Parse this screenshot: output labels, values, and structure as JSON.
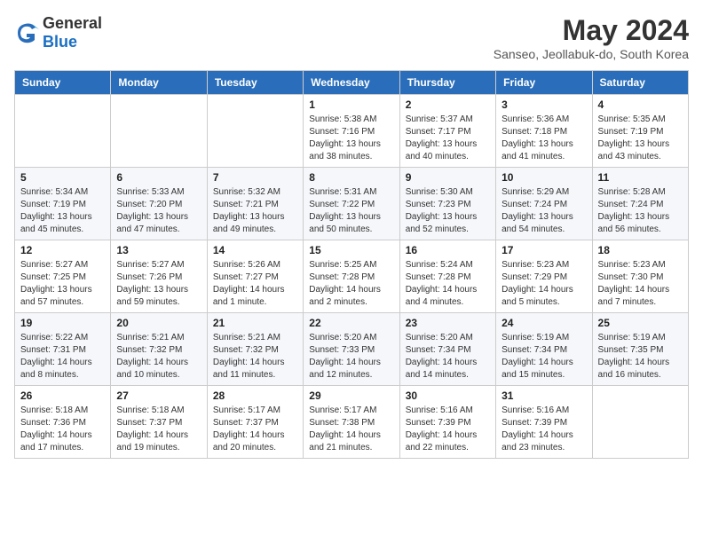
{
  "header": {
    "logo_general": "General",
    "logo_blue": "Blue",
    "month_title": "May 2024",
    "subtitle": "Sanseo, Jeollabuk-do, South Korea"
  },
  "weekdays": [
    "Sunday",
    "Monday",
    "Tuesday",
    "Wednesday",
    "Thursday",
    "Friday",
    "Saturday"
  ],
  "weeks": [
    [
      {
        "day": "",
        "info": ""
      },
      {
        "day": "",
        "info": ""
      },
      {
        "day": "",
        "info": ""
      },
      {
        "day": "1",
        "info": "Sunrise: 5:38 AM\nSunset: 7:16 PM\nDaylight: 13 hours\nand 38 minutes."
      },
      {
        "day": "2",
        "info": "Sunrise: 5:37 AM\nSunset: 7:17 PM\nDaylight: 13 hours\nand 40 minutes."
      },
      {
        "day": "3",
        "info": "Sunrise: 5:36 AM\nSunset: 7:18 PM\nDaylight: 13 hours\nand 41 minutes."
      },
      {
        "day": "4",
        "info": "Sunrise: 5:35 AM\nSunset: 7:19 PM\nDaylight: 13 hours\nand 43 minutes."
      }
    ],
    [
      {
        "day": "5",
        "info": "Sunrise: 5:34 AM\nSunset: 7:19 PM\nDaylight: 13 hours\nand 45 minutes."
      },
      {
        "day": "6",
        "info": "Sunrise: 5:33 AM\nSunset: 7:20 PM\nDaylight: 13 hours\nand 47 minutes."
      },
      {
        "day": "7",
        "info": "Sunrise: 5:32 AM\nSunset: 7:21 PM\nDaylight: 13 hours\nand 49 minutes."
      },
      {
        "day": "8",
        "info": "Sunrise: 5:31 AM\nSunset: 7:22 PM\nDaylight: 13 hours\nand 50 minutes."
      },
      {
        "day": "9",
        "info": "Sunrise: 5:30 AM\nSunset: 7:23 PM\nDaylight: 13 hours\nand 52 minutes."
      },
      {
        "day": "10",
        "info": "Sunrise: 5:29 AM\nSunset: 7:24 PM\nDaylight: 13 hours\nand 54 minutes."
      },
      {
        "day": "11",
        "info": "Sunrise: 5:28 AM\nSunset: 7:24 PM\nDaylight: 13 hours\nand 56 minutes."
      }
    ],
    [
      {
        "day": "12",
        "info": "Sunrise: 5:27 AM\nSunset: 7:25 PM\nDaylight: 13 hours\nand 57 minutes."
      },
      {
        "day": "13",
        "info": "Sunrise: 5:27 AM\nSunset: 7:26 PM\nDaylight: 13 hours\nand 59 minutes."
      },
      {
        "day": "14",
        "info": "Sunrise: 5:26 AM\nSunset: 7:27 PM\nDaylight: 14 hours\nand 1 minute."
      },
      {
        "day": "15",
        "info": "Sunrise: 5:25 AM\nSunset: 7:28 PM\nDaylight: 14 hours\nand 2 minutes."
      },
      {
        "day": "16",
        "info": "Sunrise: 5:24 AM\nSunset: 7:28 PM\nDaylight: 14 hours\nand 4 minutes."
      },
      {
        "day": "17",
        "info": "Sunrise: 5:23 AM\nSunset: 7:29 PM\nDaylight: 14 hours\nand 5 minutes."
      },
      {
        "day": "18",
        "info": "Sunrise: 5:23 AM\nSunset: 7:30 PM\nDaylight: 14 hours\nand 7 minutes."
      }
    ],
    [
      {
        "day": "19",
        "info": "Sunrise: 5:22 AM\nSunset: 7:31 PM\nDaylight: 14 hours\nand 8 minutes."
      },
      {
        "day": "20",
        "info": "Sunrise: 5:21 AM\nSunset: 7:32 PM\nDaylight: 14 hours\nand 10 minutes."
      },
      {
        "day": "21",
        "info": "Sunrise: 5:21 AM\nSunset: 7:32 PM\nDaylight: 14 hours\nand 11 minutes."
      },
      {
        "day": "22",
        "info": "Sunrise: 5:20 AM\nSunset: 7:33 PM\nDaylight: 14 hours\nand 12 minutes."
      },
      {
        "day": "23",
        "info": "Sunrise: 5:20 AM\nSunset: 7:34 PM\nDaylight: 14 hours\nand 14 minutes."
      },
      {
        "day": "24",
        "info": "Sunrise: 5:19 AM\nSunset: 7:34 PM\nDaylight: 14 hours\nand 15 minutes."
      },
      {
        "day": "25",
        "info": "Sunrise: 5:19 AM\nSunset: 7:35 PM\nDaylight: 14 hours\nand 16 minutes."
      }
    ],
    [
      {
        "day": "26",
        "info": "Sunrise: 5:18 AM\nSunset: 7:36 PM\nDaylight: 14 hours\nand 17 minutes."
      },
      {
        "day": "27",
        "info": "Sunrise: 5:18 AM\nSunset: 7:37 PM\nDaylight: 14 hours\nand 19 minutes."
      },
      {
        "day": "28",
        "info": "Sunrise: 5:17 AM\nSunset: 7:37 PM\nDaylight: 14 hours\nand 20 minutes."
      },
      {
        "day": "29",
        "info": "Sunrise: 5:17 AM\nSunset: 7:38 PM\nDaylight: 14 hours\nand 21 minutes."
      },
      {
        "day": "30",
        "info": "Sunrise: 5:16 AM\nSunset: 7:39 PM\nDaylight: 14 hours\nand 22 minutes."
      },
      {
        "day": "31",
        "info": "Sunrise: 5:16 AM\nSunset: 7:39 PM\nDaylight: 14 hours\nand 23 minutes."
      },
      {
        "day": "",
        "info": ""
      }
    ]
  ]
}
